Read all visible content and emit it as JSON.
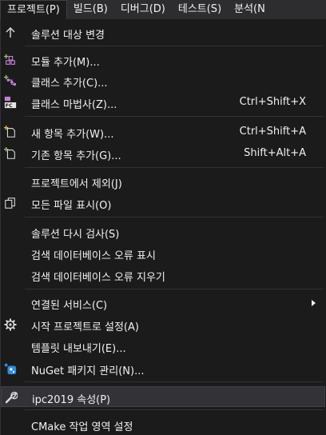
{
  "menubar": {
    "items": [
      {
        "label": "프로젝트(P)"
      },
      {
        "label": "빌드(B)"
      },
      {
        "label": "디버그(D)"
      },
      {
        "label": "테스트(S)"
      },
      {
        "label": "분석(N"
      }
    ]
  },
  "menu": {
    "items": [
      {
        "label": "솔루션 대상 변경",
        "icon": "up-arrow-icon"
      },
      {
        "label": "모듈 추가(M)...",
        "icon": "add-module-icon"
      },
      {
        "label": "클래스 추가(C)...",
        "icon": "add-class-icon"
      },
      {
        "label": "클래스 마법사(Z)...",
        "shortcut": "Ctrl+Shift+X",
        "icon": "class-wizard-icon"
      },
      {
        "label": "새 항목 추가(W)...",
        "shortcut": "Ctrl+Shift+A",
        "icon": "new-item-icon"
      },
      {
        "label": "기존 항목 추가(G)...",
        "shortcut": "Shift+Alt+A",
        "icon": "existing-item-icon"
      },
      {
        "label": "프로젝트에서 제외(J)"
      },
      {
        "label": "모든 파일 표시(O)",
        "icon": "show-all-files-icon"
      },
      {
        "label": "솔루션 다시 검사(S)"
      },
      {
        "label": "검색 데이터베이스 오류 표시"
      },
      {
        "label": "검색 데이터베이스 오류 지우기"
      },
      {
        "label": "연결된 서비스(C)",
        "has_submenu": true
      },
      {
        "label": "시작 프로젝트로 설정(A)",
        "icon": "gear-icon"
      },
      {
        "label": "템플릿 내보내기(E)..."
      },
      {
        "label": "NuGet 패키지 관리(N)...",
        "icon": "nuget-icon"
      },
      {
        "label": "ipc2019 속성(P)",
        "icon": "wrench-icon",
        "highlighted": true
      },
      {
        "label": "CMake 작업 영역 설정"
      }
    ]
  },
  "colors": {
    "accent_purple": "#c27fd6",
    "accent_green": "#8ac36b",
    "nuget_blue": "#2f8ddd"
  }
}
